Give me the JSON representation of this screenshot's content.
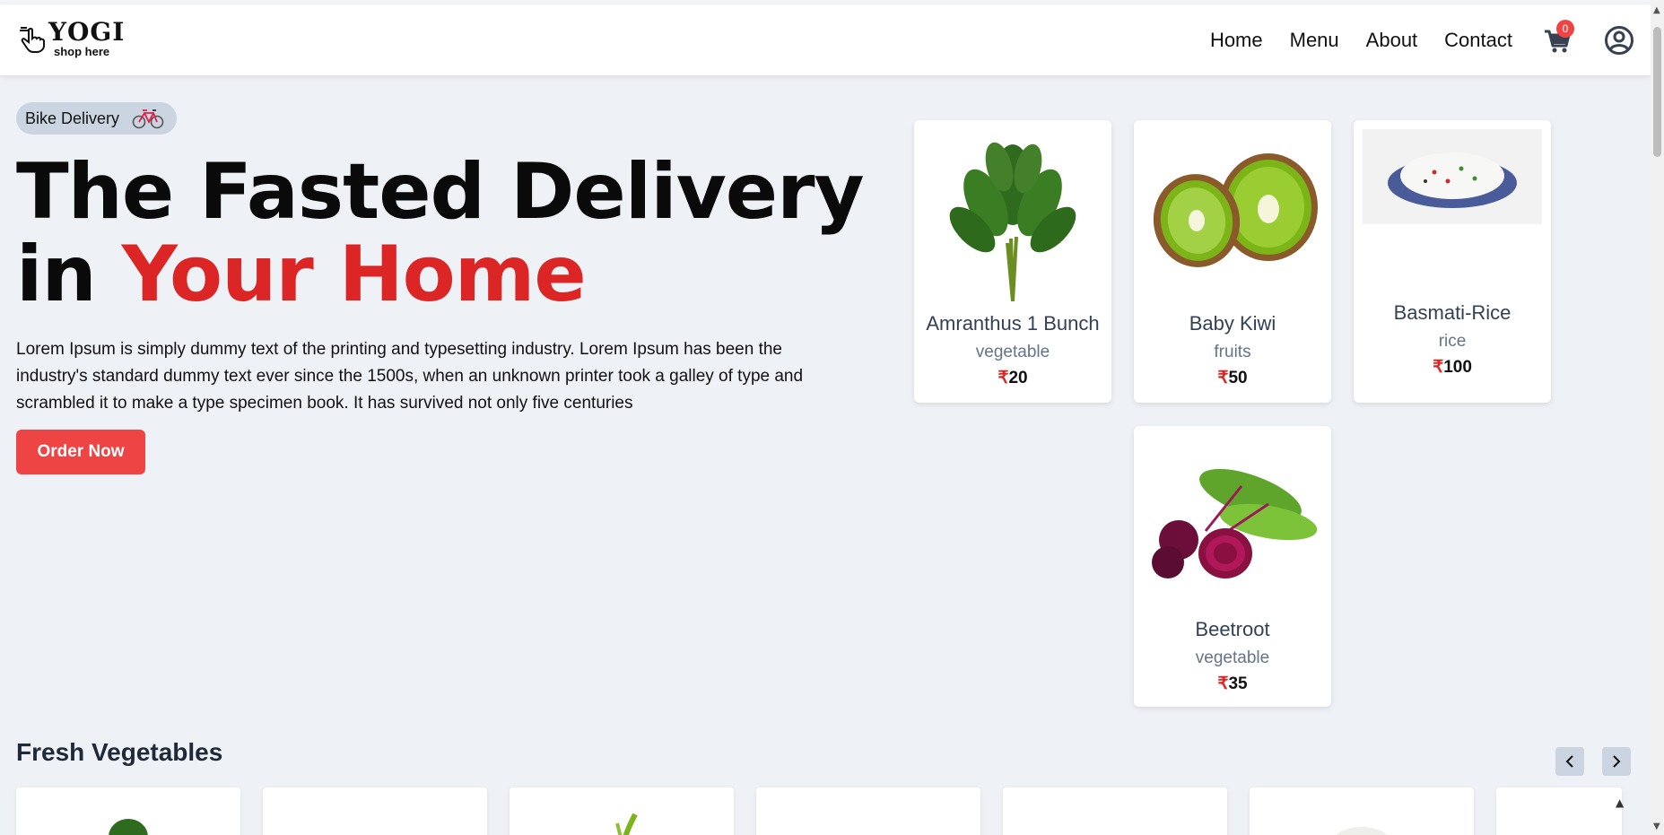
{
  "brand": {
    "name": "YOGI",
    "tagline": "shop here",
    "logo_icon": "hand-pointer-icon"
  },
  "nav": {
    "items": [
      {
        "label": "Home"
      },
      {
        "label": "Menu"
      },
      {
        "label": "About"
      },
      {
        "label": "Contact"
      }
    ],
    "cart_count": "0",
    "cart_icon": "cart-icon",
    "user_icon": "user-circle-icon"
  },
  "hero": {
    "badge": "Bike Delivery",
    "badge_icon": "bicycle-icon",
    "title_line1": "The Fasted Delivery",
    "title_in": "in",
    "title_highlight": "Your Home",
    "description": "Lorem Ipsum is simply dummy text of the printing and typesetting industry. Lorem Ipsum has been the industry's standard dummy text ever since the 1500s, when an unknown printer took a galley of type and scrambled it to make a type specimen book. It has survived not only five centuries",
    "cta": "Order Now"
  },
  "products": [
    {
      "name": "Amranthus 1 Bunch",
      "category": "vegetable",
      "currency": "₹",
      "price": "20"
    },
    {
      "name": "Baby Kiwi",
      "category": "fruits",
      "currency": "₹",
      "price": "50"
    },
    {
      "name": "Basmati-Rice",
      "category": "rice",
      "currency": "₹",
      "price": "100"
    },
    {
      "name": "Beetroot",
      "category": "vegetable",
      "currency": "₹",
      "price": "35"
    }
  ],
  "section": {
    "title": "Fresh Vegetables"
  },
  "colors": {
    "accent": "#ef4444",
    "highlight": "#dc2626",
    "bg": "#eef1f6",
    "badge": "#cbd5e1"
  }
}
